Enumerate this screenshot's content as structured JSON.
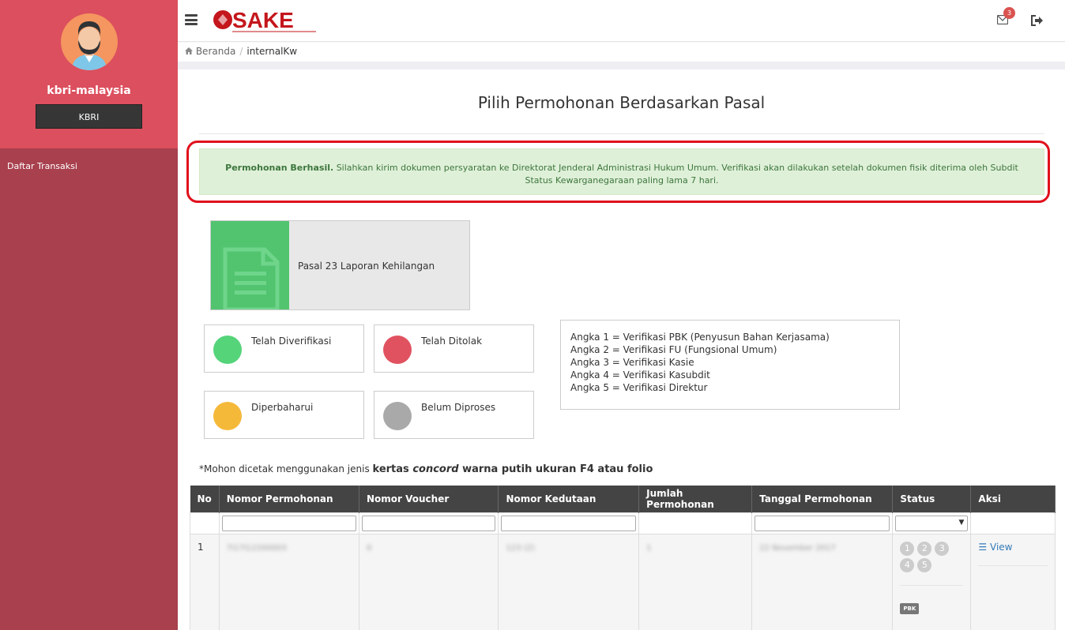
{
  "user": {
    "name": "kbri-malaysia",
    "role": "KBRI"
  },
  "sidebar": {
    "items": [
      {
        "label": "Daftar Transaksi"
      }
    ]
  },
  "header": {
    "logo_text": "SAKE",
    "mail_count": "3"
  },
  "breadcrumb": {
    "home": "Beranda",
    "current": "internalKw"
  },
  "page": {
    "title": "Pilih Permohonan Berdasarkan Pasal"
  },
  "alert": {
    "strong": "Permohonan Berhasil.",
    "message": " Silahkan kirim dokumen persyaratan ke Direktorat Jenderal Administrasi Hukum Umum. Verifikasi akan dilakukan setelah dokumen fisik diterima oleh Subdit Status Kewarganegaraan paling lama 7 hari."
  },
  "card": {
    "label": "Pasal 23 Laporan Kehilangan"
  },
  "legend": [
    {
      "label": "Telah Diverifikasi",
      "color": "#55d47a"
    },
    {
      "label": "Telah Ditolak",
      "color": "#e05260"
    },
    {
      "label": "Diperbaharui",
      "color": "#f5b93a"
    },
    {
      "label": "Belum Diproses",
      "color": "#a9a9a9"
    }
  ],
  "info": {
    "lines": [
      "Angka 1 = Verifikasi PBK (Penyusun Bahan Kerjasama)",
      "Angka 2 = Verifikasi FU (Fungsional Umum)",
      "Angka 3 = Verifikasi Kasie",
      "Angka 4 = Verifikasi Kasubdit",
      "Angka 5 = Verifikasi Direktur"
    ]
  },
  "note": {
    "prefix": "*Mohon dicetak menggunakan jenis ",
    "b1": "kertas ",
    "b2": "concord",
    "b3": " warna putih ukuran F4 atau folio"
  },
  "table": {
    "headers": [
      "No",
      "Nomor Permohonan",
      "Nomor Voucher",
      "Nomor Kedutaan",
      "Jumlah Permohonan",
      "Tanggal Permohonan",
      "Status",
      "Aksi"
    ],
    "rows": [
      {
        "no": "1",
        "nomor_permohonan": "7I17I12200003",
        "nomor_voucher": "0",
        "nomor_kedutaan": "123 (2)",
        "jumlah": "1",
        "tanggal": "22 November 2017",
        "status_steps": [
          "1",
          "2",
          "3",
          "4",
          "5"
        ],
        "status_tag": "PBK",
        "aksi": "View"
      }
    ]
  }
}
